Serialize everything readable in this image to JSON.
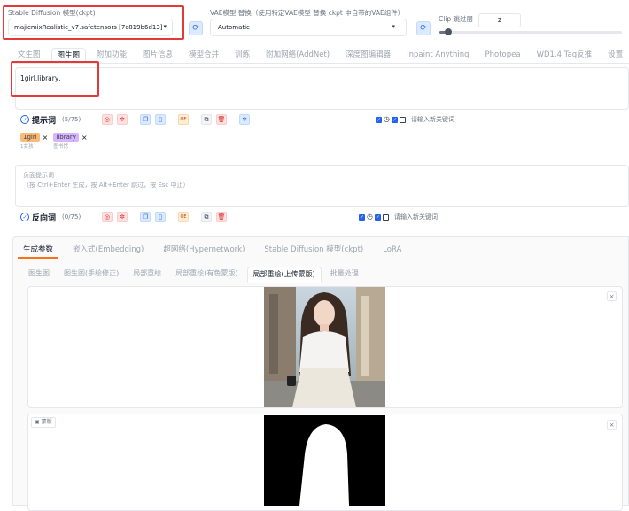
{
  "checkpoint": {
    "label": "Stable Diffusion 模型(ckpt)",
    "value": "majicmixRealistic_v7.safetensors [7c819b6d13]"
  },
  "vae": {
    "label": "VAE模型 替换（使用特定VAE模型 替换 ckpt 中自带的VAE组件）",
    "value": "Automatic"
  },
  "clip": {
    "label": "Clip 跳过层",
    "value": "2",
    "slider_fraction": 0.05
  },
  "main_tabs": [
    "文生图",
    "图生图",
    "附加功能",
    "图片信息",
    "模型合并",
    "训练",
    "附加网络(AddNet)",
    "深度图编辑器",
    "Inpaint Anything",
    "Photopea",
    "WD1.4 Tag反推",
    "设置"
  ],
  "active_main_tab": "图生图",
  "prompt": {
    "text": "1girl,library,",
    "title": "提示词",
    "count": "(5/75)",
    "keyword_placeholder": "请输入新关键词",
    "tags": [
      {
        "text": "1girl",
        "translation": "1女孩",
        "color": "#fdba74"
      },
      {
        "text": "library",
        "translation": "图书馆",
        "color": "#d8b4fe"
      }
    ]
  },
  "negative": {
    "placeholder": "负面提示词\n（按 Ctrl+Enter 生成，按 Alt+Enter 跳过，按 Esc 中止）",
    "title": "反向词",
    "count": "(0/75)",
    "keyword_placeholder": "请输入新关键词"
  },
  "toolbar_icons": {
    "o_label": "OE"
  },
  "param_tabs": [
    "生成参数",
    "嵌入式(Embedding)",
    "超网络(Hypernetwork)",
    "Stable Diffusion 模型(ckpt)",
    "LoRA"
  ],
  "sub_tabs": [
    "图生图",
    "图生图(手绘修正)",
    "局部重绘",
    "局部重绘(有色蒙版)",
    "局部重绘(上传蒙版)",
    "批量处理"
  ],
  "active_sub_tab": "局部重绘(上传蒙版)",
  "mask_label": "蒙版",
  "close_glyph": "×",
  "colors": {
    "accent": "#2563eb",
    "highlight": "#e53935"
  }
}
